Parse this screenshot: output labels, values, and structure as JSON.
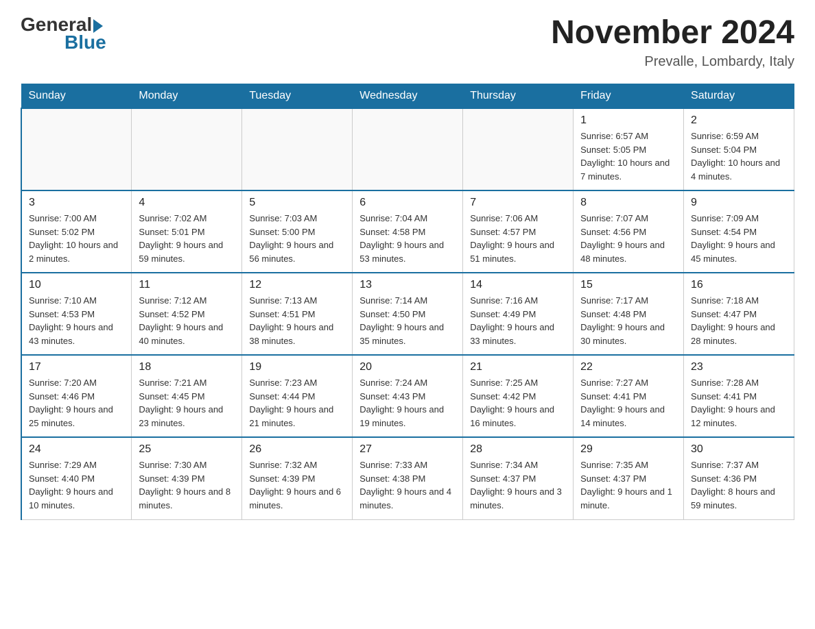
{
  "header": {
    "logo_general": "General",
    "logo_blue": "Blue",
    "month_year": "November 2024",
    "location": "Prevalle, Lombardy, Italy"
  },
  "days_of_week": [
    "Sunday",
    "Monday",
    "Tuesday",
    "Wednesday",
    "Thursday",
    "Friday",
    "Saturday"
  ],
  "weeks": [
    [
      {
        "day": "",
        "info": ""
      },
      {
        "day": "",
        "info": ""
      },
      {
        "day": "",
        "info": ""
      },
      {
        "day": "",
        "info": ""
      },
      {
        "day": "",
        "info": ""
      },
      {
        "day": "1",
        "info": "Sunrise: 6:57 AM\nSunset: 5:05 PM\nDaylight: 10 hours and 7 minutes."
      },
      {
        "day": "2",
        "info": "Sunrise: 6:59 AM\nSunset: 5:04 PM\nDaylight: 10 hours and 4 minutes."
      }
    ],
    [
      {
        "day": "3",
        "info": "Sunrise: 7:00 AM\nSunset: 5:02 PM\nDaylight: 10 hours and 2 minutes."
      },
      {
        "day": "4",
        "info": "Sunrise: 7:02 AM\nSunset: 5:01 PM\nDaylight: 9 hours and 59 minutes."
      },
      {
        "day": "5",
        "info": "Sunrise: 7:03 AM\nSunset: 5:00 PM\nDaylight: 9 hours and 56 minutes."
      },
      {
        "day": "6",
        "info": "Sunrise: 7:04 AM\nSunset: 4:58 PM\nDaylight: 9 hours and 53 minutes."
      },
      {
        "day": "7",
        "info": "Sunrise: 7:06 AM\nSunset: 4:57 PM\nDaylight: 9 hours and 51 minutes."
      },
      {
        "day": "8",
        "info": "Sunrise: 7:07 AM\nSunset: 4:56 PM\nDaylight: 9 hours and 48 minutes."
      },
      {
        "day": "9",
        "info": "Sunrise: 7:09 AM\nSunset: 4:54 PM\nDaylight: 9 hours and 45 minutes."
      }
    ],
    [
      {
        "day": "10",
        "info": "Sunrise: 7:10 AM\nSunset: 4:53 PM\nDaylight: 9 hours and 43 minutes."
      },
      {
        "day": "11",
        "info": "Sunrise: 7:12 AM\nSunset: 4:52 PM\nDaylight: 9 hours and 40 minutes."
      },
      {
        "day": "12",
        "info": "Sunrise: 7:13 AM\nSunset: 4:51 PM\nDaylight: 9 hours and 38 minutes."
      },
      {
        "day": "13",
        "info": "Sunrise: 7:14 AM\nSunset: 4:50 PM\nDaylight: 9 hours and 35 minutes."
      },
      {
        "day": "14",
        "info": "Sunrise: 7:16 AM\nSunset: 4:49 PM\nDaylight: 9 hours and 33 minutes."
      },
      {
        "day": "15",
        "info": "Sunrise: 7:17 AM\nSunset: 4:48 PM\nDaylight: 9 hours and 30 minutes."
      },
      {
        "day": "16",
        "info": "Sunrise: 7:18 AM\nSunset: 4:47 PM\nDaylight: 9 hours and 28 minutes."
      }
    ],
    [
      {
        "day": "17",
        "info": "Sunrise: 7:20 AM\nSunset: 4:46 PM\nDaylight: 9 hours and 25 minutes."
      },
      {
        "day": "18",
        "info": "Sunrise: 7:21 AM\nSunset: 4:45 PM\nDaylight: 9 hours and 23 minutes."
      },
      {
        "day": "19",
        "info": "Sunrise: 7:23 AM\nSunset: 4:44 PM\nDaylight: 9 hours and 21 minutes."
      },
      {
        "day": "20",
        "info": "Sunrise: 7:24 AM\nSunset: 4:43 PM\nDaylight: 9 hours and 19 minutes."
      },
      {
        "day": "21",
        "info": "Sunrise: 7:25 AM\nSunset: 4:42 PM\nDaylight: 9 hours and 16 minutes."
      },
      {
        "day": "22",
        "info": "Sunrise: 7:27 AM\nSunset: 4:41 PM\nDaylight: 9 hours and 14 minutes."
      },
      {
        "day": "23",
        "info": "Sunrise: 7:28 AM\nSunset: 4:41 PM\nDaylight: 9 hours and 12 minutes."
      }
    ],
    [
      {
        "day": "24",
        "info": "Sunrise: 7:29 AM\nSunset: 4:40 PM\nDaylight: 9 hours and 10 minutes."
      },
      {
        "day": "25",
        "info": "Sunrise: 7:30 AM\nSunset: 4:39 PM\nDaylight: 9 hours and 8 minutes."
      },
      {
        "day": "26",
        "info": "Sunrise: 7:32 AM\nSunset: 4:39 PM\nDaylight: 9 hours and 6 minutes."
      },
      {
        "day": "27",
        "info": "Sunrise: 7:33 AM\nSunset: 4:38 PM\nDaylight: 9 hours and 4 minutes."
      },
      {
        "day": "28",
        "info": "Sunrise: 7:34 AM\nSunset: 4:37 PM\nDaylight: 9 hours and 3 minutes."
      },
      {
        "day": "29",
        "info": "Sunrise: 7:35 AM\nSunset: 4:37 PM\nDaylight: 9 hours and 1 minute."
      },
      {
        "day": "30",
        "info": "Sunrise: 7:37 AM\nSunset: 4:36 PM\nDaylight: 8 hours and 59 minutes."
      }
    ]
  ]
}
